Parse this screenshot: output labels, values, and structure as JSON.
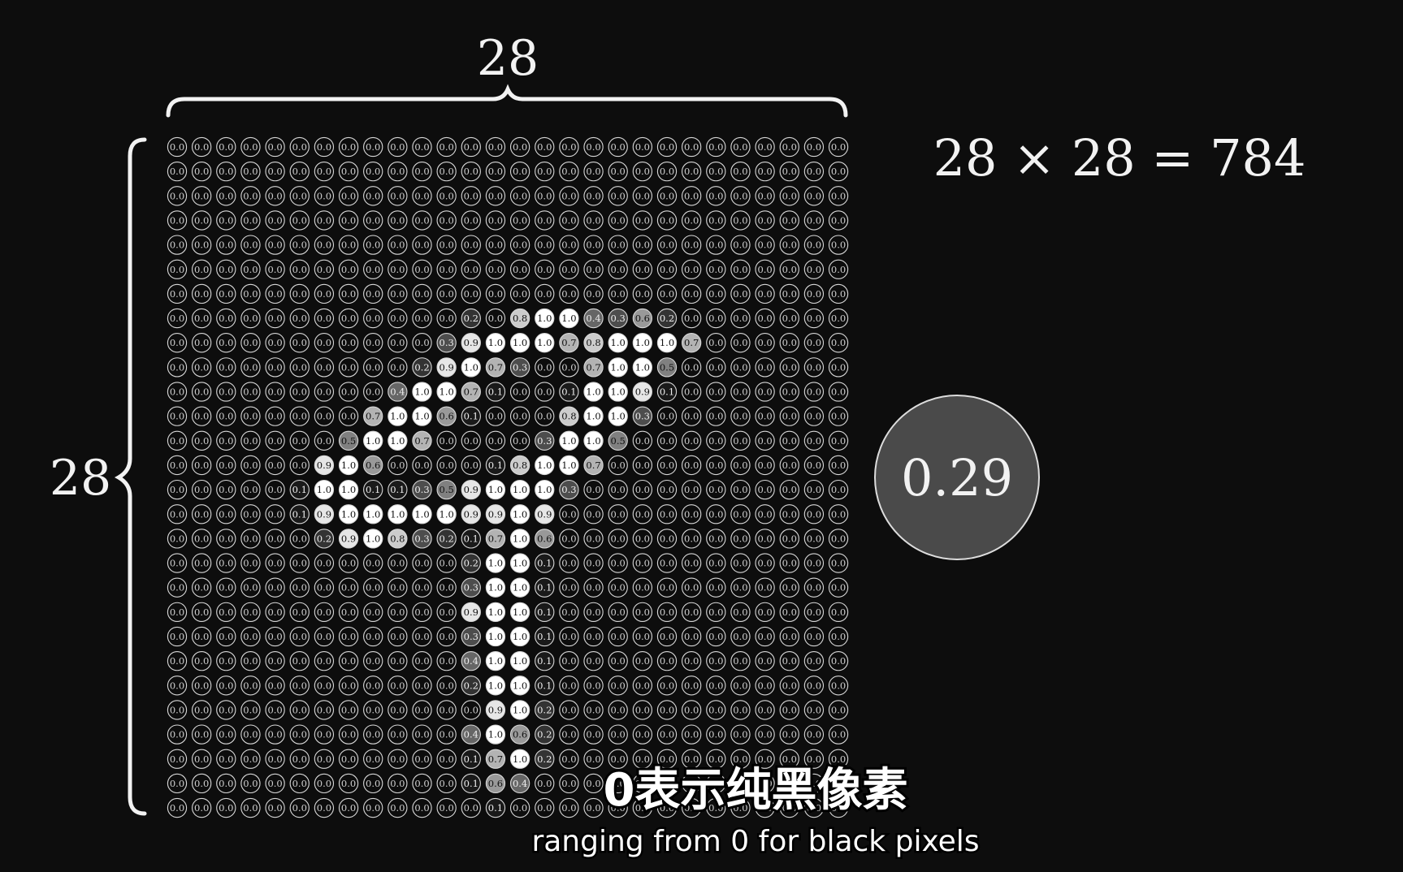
{
  "labels": {
    "width_label": "28",
    "height_label": "28",
    "equation": "28 × 28 = 784",
    "magnified_value": "0.29"
  },
  "subtitles": {
    "zh": "0表示纯黑像素",
    "en": "ranging from 0 for black pixels"
  },
  "grid": {
    "rows": 28,
    "cols": 28,
    "nonzero_cells": [
      [
        7,
        12,
        0.2
      ],
      [
        7,
        14,
        0.8
      ],
      [
        7,
        15,
        1.0
      ],
      [
        7,
        16,
        1.0
      ],
      [
        7,
        17,
        0.4
      ],
      [
        7,
        18,
        0.3
      ],
      [
        7,
        19,
        0.6
      ],
      [
        7,
        20,
        0.2
      ],
      [
        8,
        11,
        0.3
      ],
      [
        8,
        12,
        0.9
      ],
      [
        8,
        13,
        1.0
      ],
      [
        8,
        14,
        1.0
      ],
      [
        8,
        15,
        1.0
      ],
      [
        8,
        16,
        0.7
      ],
      [
        8,
        17,
        0.8
      ],
      [
        8,
        18,
        1.0
      ],
      [
        8,
        19,
        1.0
      ],
      [
        8,
        20,
        1.0
      ],
      [
        8,
        21,
        0.7
      ],
      [
        9,
        10,
        0.2
      ],
      [
        9,
        11,
        0.9
      ],
      [
        9,
        12,
        1.0
      ],
      [
        9,
        13,
        0.7
      ],
      [
        9,
        14,
        0.3
      ],
      [
        9,
        17,
        0.7
      ],
      [
        9,
        18,
        1.0
      ],
      [
        9,
        19,
        1.0
      ],
      [
        9,
        20,
        0.5
      ],
      [
        10,
        9,
        0.4
      ],
      [
        10,
        10,
        1.0
      ],
      [
        10,
        11,
        1.0
      ],
      [
        10,
        12,
        0.7
      ],
      [
        10,
        13,
        0.1
      ],
      [
        10,
        16,
        0.1
      ],
      [
        10,
        17,
        1.0
      ],
      [
        10,
        18,
        1.0
      ],
      [
        10,
        19,
        0.9
      ],
      [
        10,
        20,
        0.1
      ],
      [
        11,
        8,
        0.7
      ],
      [
        11,
        9,
        1.0
      ],
      [
        11,
        10,
        1.0
      ],
      [
        11,
        11,
        0.6
      ],
      [
        11,
        12,
        0.1
      ],
      [
        11,
        16,
        0.8
      ],
      [
        11,
        17,
        1.0
      ],
      [
        11,
        18,
        1.0
      ],
      [
        11,
        19,
        0.3
      ],
      [
        12,
        7,
        0.5
      ],
      [
        12,
        8,
        1.0
      ],
      [
        12,
        9,
        1.0
      ],
      [
        12,
        10,
        0.7
      ],
      [
        12,
        15,
        0.3
      ],
      [
        12,
        16,
        1.0
      ],
      [
        12,
        17,
        1.0
      ],
      [
        12,
        18,
        0.5
      ],
      [
        13,
        6,
        0.9
      ],
      [
        13,
        7,
        1.0
      ],
      [
        13,
        8,
        0.6
      ],
      [
        13,
        13,
        0.1
      ],
      [
        13,
        14,
        0.8
      ],
      [
        13,
        15,
        1.0
      ],
      [
        13,
        16,
        1.0
      ],
      [
        13,
        17,
        0.7
      ],
      [
        14,
        5,
        0.1
      ],
      [
        14,
        6,
        1.0
      ],
      [
        14,
        7,
        1.0
      ],
      [
        14,
        8,
        0.1
      ],
      [
        14,
        9,
        0.1
      ],
      [
        14,
        10,
        0.3
      ],
      [
        14,
        11,
        0.5
      ],
      [
        14,
        12,
        0.9
      ],
      [
        14,
        13,
        1.0
      ],
      [
        14,
        14,
        1.0
      ],
      [
        14,
        15,
        1.0
      ],
      [
        14,
        16,
        0.3
      ],
      [
        15,
        5,
        0.1
      ],
      [
        15,
        6,
        0.9
      ],
      [
        15,
        7,
        1.0
      ],
      [
        15,
        8,
        1.0
      ],
      [
        15,
        9,
        1.0
      ],
      [
        15,
        10,
        1.0
      ],
      [
        15,
        11,
        1.0
      ],
      [
        15,
        12,
        0.9
      ],
      [
        15,
        13,
        0.9
      ],
      [
        15,
        14,
        1.0
      ],
      [
        15,
        15,
        0.9
      ],
      [
        16,
        6,
        0.2
      ],
      [
        16,
        7,
        0.9
      ],
      [
        16,
        8,
        1.0
      ],
      [
        16,
        9,
        0.8
      ],
      [
        16,
        10,
        0.3
      ],
      [
        16,
        11,
        0.2
      ],
      [
        16,
        12,
        0.1
      ],
      [
        16,
        13,
        0.7
      ],
      [
        16,
        14,
        1.0
      ],
      [
        16,
        15,
        0.6
      ],
      [
        17,
        12,
        0.2
      ],
      [
        17,
        13,
        1.0
      ],
      [
        17,
        14,
        1.0
      ],
      [
        17,
        15,
        0.1
      ],
      [
        18,
        12,
        0.3
      ],
      [
        18,
        13,
        1.0
      ],
      [
        18,
        14,
        1.0
      ],
      [
        18,
        15,
        0.1
      ],
      [
        19,
        12,
        0.9
      ],
      [
        19,
        13,
        1.0
      ],
      [
        19,
        14,
        1.0
      ],
      [
        19,
        15,
        0.1
      ],
      [
        20,
        12,
        0.3
      ],
      [
        20,
        13,
        1.0
      ],
      [
        20,
        14,
        1.0
      ],
      [
        20,
        15,
        0.1
      ],
      [
        21,
        12,
        0.4
      ],
      [
        21,
        13,
        1.0
      ],
      [
        21,
        14,
        1.0
      ],
      [
        21,
        15,
        0.1
      ],
      [
        22,
        12,
        0.2
      ],
      [
        22,
        13,
        1.0
      ],
      [
        22,
        14,
        1.0
      ],
      [
        22,
        15,
        0.1
      ],
      [
        23,
        13,
        0.9
      ],
      [
        23,
        14,
        1.0
      ],
      [
        23,
        15,
        0.2
      ],
      [
        24,
        12,
        0.4
      ],
      [
        24,
        13,
        1.0
      ],
      [
        24,
        14,
        0.6
      ],
      [
        24,
        15,
        0.2
      ],
      [
        25,
        12,
        0.1
      ],
      [
        25,
        13,
        0.7
      ],
      [
        25,
        14,
        1.0
      ],
      [
        25,
        15,
        0.2
      ],
      [
        26,
        12,
        0.1
      ],
      [
        26,
        13,
        0.6
      ],
      [
        26,
        14,
        0.4
      ],
      [
        27,
        13,
        0.1
      ]
    ]
  }
}
